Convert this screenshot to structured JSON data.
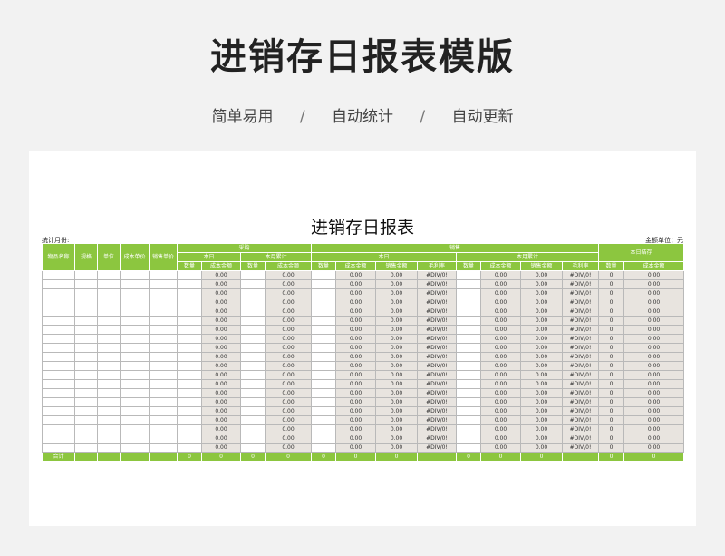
{
  "hero": {
    "title": "进销存日报表模版",
    "tags": [
      "简单易用",
      "自动统计",
      "自动更新"
    ],
    "separator": "/"
  },
  "sheet": {
    "title": "进销存日报表",
    "month_label": "统计月份:",
    "unit_label": "金额单位：元"
  },
  "header": {
    "item_name": "物品名称",
    "spec": "规格",
    "unit": "单位",
    "cost_price": "成本单价",
    "sale_price": "销售单价",
    "purchase": "采购",
    "sales": "销售",
    "stock": "本日结存",
    "today": "本日",
    "month_total": "本月累计",
    "qty": "数量",
    "cost_amount": "成本金额",
    "sale_amount": "销售金额",
    "margin": "毛利率"
  },
  "row_values": {
    "zero_amount": "0.00",
    "div_error": "#DIV/0!",
    "zero": "0"
  },
  "row_count": 20,
  "footer": {
    "label": "合计",
    "zero": "0"
  },
  "colors": {
    "header_green": "#8cc63f",
    "calc_gray": "#e8e4df"
  }
}
